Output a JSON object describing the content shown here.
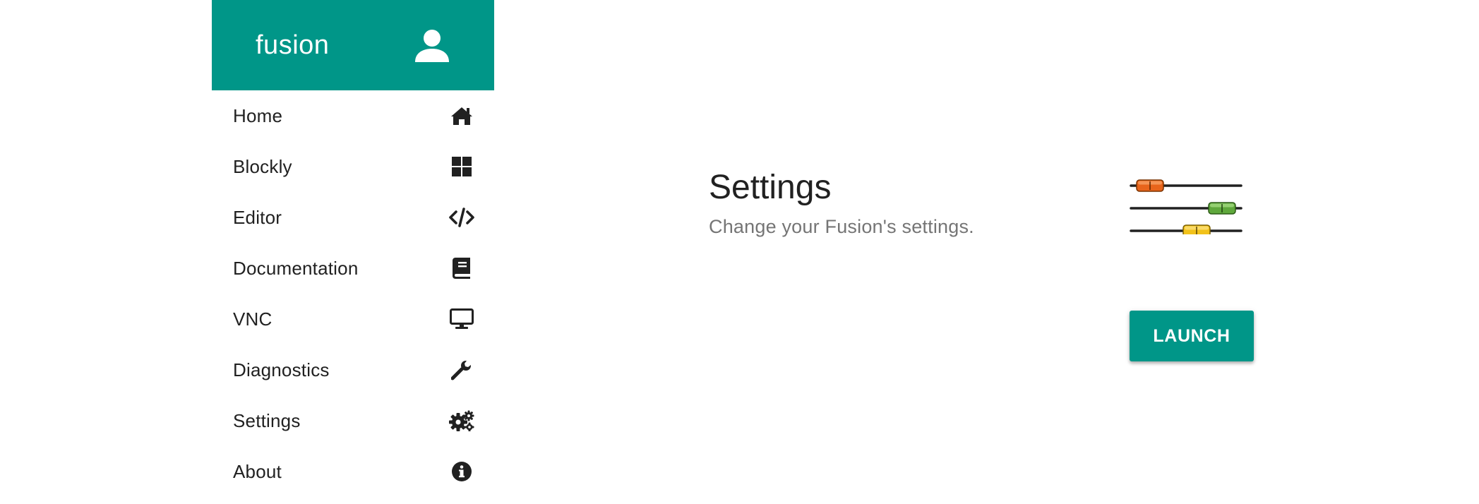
{
  "sidebar": {
    "brand": "fusion",
    "header_color": "#009688",
    "avatar_icon": "user-icon",
    "items": [
      {
        "label": "Home",
        "icon": "home-icon"
      },
      {
        "label": "Blockly",
        "icon": "grid-icon"
      },
      {
        "label": "Editor",
        "icon": "code-icon"
      },
      {
        "label": "Documentation",
        "icon": "book-icon"
      },
      {
        "label": "VNC",
        "icon": "monitor-icon"
      },
      {
        "label": "Diagnostics",
        "icon": "wrench-icon"
      },
      {
        "label": "Settings",
        "icon": "gears-icon"
      },
      {
        "label": "About",
        "icon": "info-icon"
      }
    ]
  },
  "main": {
    "title": "Settings",
    "subtitle": "Change your Fusion's settings.",
    "illustration": "sliders-icon",
    "launch_label": "LAUNCH",
    "accent": "#009688"
  }
}
